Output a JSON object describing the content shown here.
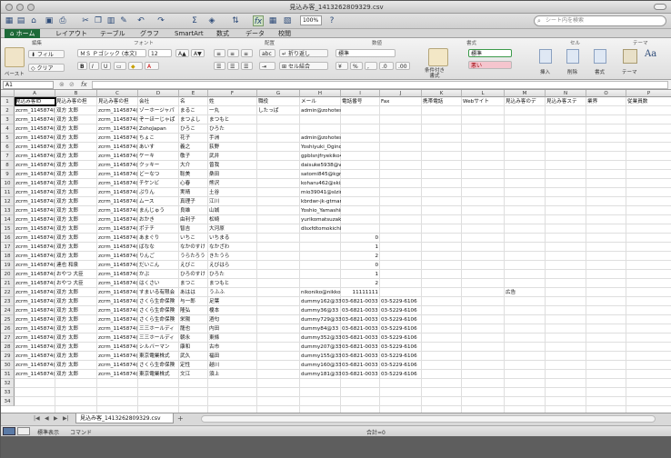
{
  "window": {
    "title": "見込み客_1413262809329.csv"
  },
  "toolbar": {
    "zoom": "100%",
    "search_placeholder": "シート内を検索"
  },
  "tabs": [
    "ホーム",
    "レイアウト",
    "テーブル",
    "グラフ",
    "SmartArt",
    "数式",
    "データ",
    "校閲"
  ],
  "ribbon": {
    "groups": {
      "edit": "編集",
      "font": "フォント",
      "align": "配置",
      "number": "数値",
      "format": "書式",
      "cell": "セル",
      "theme": "テーマ"
    },
    "fill": "フィル",
    "clear": "クリア",
    "paste": "ペースト",
    "font_name": "ＭＳ Ｐゴシック (本文)",
    "font_size": "12",
    "wrap": "折り返し",
    "merge": "セル結合",
    "number_format": "標準",
    "conditional": "条件付き\n書式",
    "style_normal": "標準",
    "style_bad": "悪い",
    "insert": "挿入",
    "delete": "削除",
    "format_btn": "書式",
    "theme_btn": "テーマ"
  },
  "formula_bar": {
    "name_box": "A1",
    "fx": "fx"
  },
  "columns": [
    "A",
    "B",
    "C",
    "D",
    "E",
    "F",
    "G",
    "H",
    "I",
    "J",
    "K",
    "L",
    "M",
    "N",
    "O",
    "P"
  ],
  "rows": [
    [
      "見込み客ID",
      "見込み客の担",
      "見込み客の担",
      "会社",
      "名",
      "姓",
      "職役",
      "メール",
      "電話番号",
      "Fax",
      "携帯電話",
      "Webサイト",
      "見込み客のデ",
      "見込み客ステ",
      "業界",
      "従業員数"
    ],
    [
      "zcrm_1145874(",
      "双方 太郎",
      "zcrm_1145874(",
      "ゾーホージャパ",
      "まるこ",
      "一丸",
      "したっぱ",
      "admin@zohotest.jp",
      "",
      "",
      "",
      "",
      "",
      "",
      "",
      ""
    ],
    [
      "zcrm_1145874(",
      "双方 太郎",
      "zcrm_1145874(",
      "ぞーほーじゃぱ",
      "まつよし",
      "まつもと",
      "",
      "",
      "",
      "",
      "",
      "",
      "",
      "",
      "",
      ""
    ],
    [
      "zcrm_1145874(",
      "双方 太郎",
      "zcrm_1145874(",
      "ZohoJapan",
      "ひろこ",
      "ひろた",
      "",
      "",
      "",
      "",
      "",
      "",
      "",
      "",
      "",
      ""
    ],
    [
      "zcrm_1145874(",
      "双方 太郎",
      "zcrm_1145874(",
      "ちょこ",
      "花子",
      "手洲",
      "",
      "admin@zohotest.jp",
      "",
      "",
      "",
      "",
      "",
      "",
      "",
      ""
    ],
    [
      "zcrm_1145874(",
      "双方 太郎",
      "zcrm_1145874(",
      "あいす",
      "義之",
      "荻野",
      "",
      "Yoshiyuki_Ogino@alm5hqqwz.trc",
      "",
      "",
      "",
      "",
      "",
      "",
      "",
      ""
    ],
    [
      "zcrm_1145874(",
      "双方 太郎",
      "zcrm_1145874(",
      "ケーキ",
      "敬子",
      "武井",
      "",
      "gpblsnjfryekiko4743@wsmfa.lp",
      "",
      "",
      "",
      "",
      "",
      "",
      "",
      ""
    ],
    [
      "zcrm_1145874(",
      "双方 太郎",
      "zcrm_1145874(",
      "クッキー",
      "大介",
      "曾我",
      "",
      "daisuke5938@vyqm.gn",
      "",
      "",
      "",
      "",
      "",
      "",
      "",
      ""
    ],
    [
      "zcrm_1145874(",
      "双方 太郎",
      "zcrm_1145874(",
      "どーなつ",
      "聡美",
      "桑田",
      "",
      "satomi845@kgnao.xi",
      "",
      "",
      "",
      "",
      "",
      "",
      "",
      ""
    ],
    [
      "zcrm_1145874(",
      "双方 太郎",
      "zcrm_1145874(",
      "チケンビ",
      "心春",
      "熊沢",
      "",
      "koharu462@skixnyjom.jyuj.ou",
      "",
      "",
      "",
      "",
      "",
      "",
      "",
      ""
    ],
    [
      "zcrm_1145874(",
      "双方 太郎",
      "zcrm_1145874(",
      "ぷりん",
      "実晴",
      "土谷",
      "",
      "mio39041@slzinif.cz.uvn",
      "",
      "",
      "",
      "",
      "",
      "",
      "",
      ""
    ],
    [
      "zcrm_1145874(",
      "双方 太郎",
      "zcrm_1145874(",
      "ムース",
      "真理子",
      "江川",
      "",
      "kbrdwr-jk-gtmariko8646@txzecqk.zq",
      "",
      "",
      "",
      "",
      "",
      "",
      "",
      ""
    ],
    [
      "zcrm_1145874(",
      "双方 太郎",
      "zcrm_1145874(",
      "まんじゅう",
      "良雄",
      "山城",
      "",
      "Yoshio_Yamashiro@bywmim.ybo",
      "",
      "",
      "",
      "",
      "",
      "",
      "",
      ""
    ],
    [
      "zcrm_1145874(",
      "双方 太郎",
      "zcrm_1145874(",
      "おかき",
      "由利子",
      "松崎",
      "",
      "yurikomatsuzaki@fufhjivisb.zxo",
      "",
      "",
      "",
      "",
      "",
      "",
      "",
      ""
    ],
    [
      "zcrm_1145874(",
      "双方 太郎",
      "zcrm_1145874(",
      "ポテチ",
      "智吉",
      "大河原",
      "",
      "dlsxfdtomokichi9905@evjmmmmfpj.qto",
      "",
      "",
      "",
      "",
      "",
      "",
      "",
      ""
    ],
    [
      "zcrm_1145874(",
      "双方 太郎",
      "zcrm_1145874(",
      "あまぐり",
      "いちこ",
      "いちまる",
      "",
      "",
      "0",
      "",
      "",
      "",
      "",
      "",
      "",
      ""
    ],
    [
      "zcrm_1145874(",
      "双方 太郎",
      "zcrm_1145874(",
      "ばなな",
      "なかのすけ",
      "なかざわ",
      "",
      "",
      "1",
      "",
      "",
      "",
      "",
      "",
      "",
      ""
    ],
    [
      "zcrm_1145874(",
      "双方 太郎",
      "zcrm_1145874(",
      "りんご",
      "うらたろう",
      "きたうら",
      "",
      "",
      "2",
      "",
      "",
      "",
      "",
      "",
      "",
      ""
    ],
    [
      "zcrm_1145874(",
      "連也 和泉",
      "zcrm_1145874(",
      "だいこん",
      "えびこ",
      "えびはら",
      "",
      "",
      "0",
      "",
      "",
      "",
      "",
      "",
      "",
      ""
    ],
    [
      "zcrm_1145874(",
      "おやつ 大臣",
      "zcrm_1145874(",
      "かぶ",
      "ひろのすけ",
      "ひろた",
      "",
      "",
      "1",
      "",
      "",
      "",
      "",
      "",
      "",
      ""
    ],
    [
      "zcrm_1145874(",
      "おやつ 大臣",
      "zcrm_1145874(",
      "はくさい",
      "まつこ",
      "まつもと",
      "",
      "",
      "2",
      "",
      "",
      "",
      "",
      "",
      "",
      ""
    ],
    [
      "zcrm_1145874(",
      "双方 太郎",
      "zcrm_1145874(",
      "すまいる有限会",
      "あはは",
      "うふふ",
      "",
      "nikoniko@nikko",
      "11111111",
      "",
      "",
      "",
      "広告",
      "",
      "",
      ""
    ],
    [
      "zcrm_1145874(",
      "双方 太郎",
      "zcrm_1145874(",
      "さくら生命保険",
      "与一郎",
      "足葉",
      "",
      "dummy162@33",
      "03-6821-0033",
      "03-5229-6106",
      "",
      "",
      "",
      "",
      "",
      ""
    ],
    [
      "zcrm_1145874(",
      "双方 太郎",
      "zcrm_1145874(",
      "さくら生命保険",
      "隆弘",
      "榎本",
      "",
      "dummy36@33",
      "03-6821-0033",
      "03-5229-6106",
      "",
      "",
      "",
      "",
      "",
      ""
    ],
    [
      "zcrm_1145874(",
      "双方 太郎",
      "zcrm_1145874(",
      "さくら生命保険",
      "栄陽",
      "酒匂",
      "",
      "dummy729@33",
      "03-6821-0033",
      "03-5229-6106",
      "",
      "",
      "",
      "",
      "",
      ""
    ],
    [
      "zcrm_1145874(",
      "双方 太郎",
      "zcrm_1145874(",
      "三三ホールディ",
      "龍也",
      "内田",
      "",
      "dummy84@33",
      "03-6821-0033",
      "03-5229-6106",
      "",
      "",
      "",
      "",
      "",
      ""
    ],
    [
      "zcrm_1145874(",
      "双方 太郎",
      "zcrm_1145874(",
      "三三ホールディ",
      "朝永",
      "東條",
      "",
      "dummy352@33",
      "03-6821-0033",
      "03-5229-6106",
      "",
      "",
      "",
      "",
      "",
      ""
    ],
    [
      "zcrm_1145874(",
      "双方 太郎",
      "zcrm_1145874(",
      "シルバーマン",
      "康和",
      "古市",
      "",
      "dummy207@33",
      "03-6821-0033",
      "03-5229-6106",
      "",
      "",
      "",
      "",
      "",
      ""
    ],
    [
      "zcrm_1145874(",
      "双方 太郎",
      "zcrm_1145874(",
      "東京電業株式",
      "武久",
      "福田",
      "",
      "dummy155@33",
      "03-6821-0033",
      "03-5229-6106",
      "",
      "",
      "",
      "",
      "",
      ""
    ],
    [
      "zcrm_1145874(",
      "双方 太郎",
      "zcrm_1145874(",
      "さくら生命保険",
      "定性",
      "越川",
      "",
      "dummy160@33",
      "03-6821-0033",
      "03-5229-6106",
      "",
      "",
      "",
      "",
      "",
      ""
    ],
    [
      "zcrm_1145874(",
      "双方 太郎",
      "zcrm_1145874(",
      "東京電業株式",
      "文江",
      "須上",
      "",
      "dummy181@33",
      "03-6821-0033",
      "03-5229-6106",
      "",
      "",
      "",
      "",
      "",
      ""
    ]
  ],
  "sheet_tab": "見込み客_1413262809329.csv",
  "status": {
    "mode": "標準表示",
    "ready": "コマンド",
    "sum": "合計=0"
  }
}
